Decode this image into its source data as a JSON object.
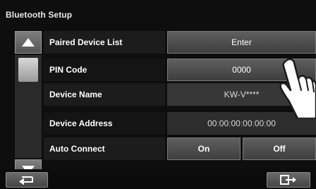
{
  "screen": {
    "title": "Bluetooth Setup"
  },
  "scroll": {
    "up_icon": "triangle-up-icon",
    "down_icon": "triangle-down-icon"
  },
  "rows": [
    {
      "label": "Paired Device List",
      "value": "Enter"
    },
    {
      "label": "PIN Code",
      "value": "0000"
    },
    {
      "label": "Device Name",
      "value": "KW-V****"
    },
    {
      "label": "Device Address",
      "value": "00ː00ː00ː00ː00ː00"
    },
    {
      "label": "Auto Connect",
      "option_on": "On",
      "option_off": "Off"
    }
  ],
  "bottom": {
    "back_icon": "back-arrow-icon",
    "exit_icon": "exit-icon"
  },
  "colors": {
    "background": "#0e0e0e",
    "button": "#4f4f4f",
    "text": "#ffffff"
  }
}
